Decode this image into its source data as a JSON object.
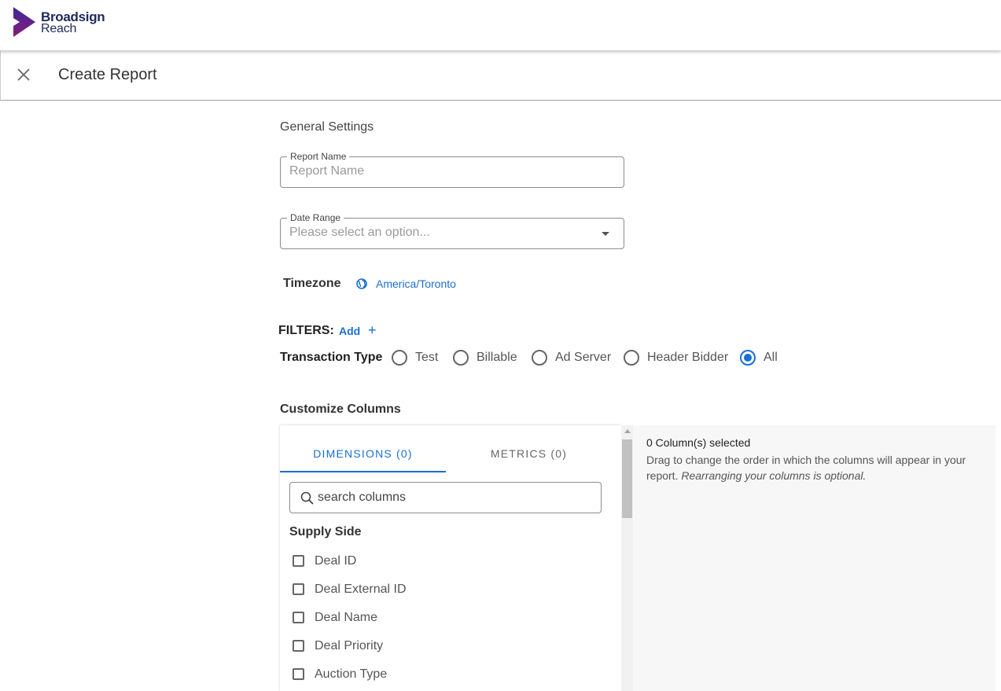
{
  "brand": {
    "line1": "Broadsign",
    "line2": "Reach"
  },
  "header": {
    "title": "Create Report"
  },
  "general": {
    "title": "General Settings",
    "report_name": {
      "label": "Report Name",
      "placeholder": "Report Name",
      "value": ""
    },
    "date_range": {
      "label": "Date Range",
      "placeholder": "Please select an option..."
    },
    "timezone": {
      "label": "Timezone",
      "value": "America/Toronto"
    }
  },
  "filters": {
    "label": "FILTERS:",
    "add": "Add",
    "plus": "+"
  },
  "transaction_type": {
    "label": "Transaction Type",
    "options": [
      {
        "label": "Test",
        "selected": false
      },
      {
        "label": "Billable",
        "selected": false
      },
      {
        "label": "Ad Server",
        "selected": false
      },
      {
        "label": "Header Bidder",
        "selected": false
      },
      {
        "label": "All",
        "selected": true
      }
    ]
  },
  "columns": {
    "title": "Customize Columns",
    "tabs": [
      {
        "label": "DIMENSIONS (0)",
        "active": true
      },
      {
        "label": "METRICS (0)",
        "active": false
      }
    ],
    "search": {
      "placeholder": "search columns"
    },
    "group": "Supply Side",
    "items": [
      {
        "label": "Deal ID",
        "checked": false
      },
      {
        "label": "Deal External ID",
        "checked": false
      },
      {
        "label": "Deal Name",
        "checked": false
      },
      {
        "label": "Deal Priority",
        "checked": false
      },
      {
        "label": "Auction Type",
        "checked": false
      }
    ],
    "selected": {
      "count": "0 Column(s) selected",
      "desc": "Drag to change the order in which the columns will appear in your report.",
      "note": "Rearranging your columns is optional."
    }
  },
  "colors": {
    "accent": "#1a6fd1",
    "brand_purple": "#5a1a8c"
  },
  "icons": {
    "close": "close-icon",
    "globe": "globe-icon",
    "search": "search-icon",
    "dropdown": "chevron-down-icon"
  }
}
